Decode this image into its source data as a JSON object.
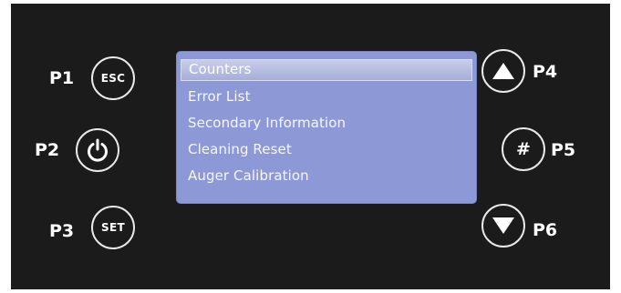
{
  "screen": {
    "menu_items": [
      {
        "label": "Counters",
        "selected": true
      },
      {
        "label": "Error List",
        "selected": false
      },
      {
        "label": "Secondary Information",
        "selected": false
      },
      {
        "label": "Cleaning Reset",
        "selected": false
      },
      {
        "label": "Auger Calibration",
        "selected": false
      }
    ]
  },
  "buttons": {
    "p1": {
      "label": "P1",
      "text": "ESC"
    },
    "p2": {
      "label": "P2",
      "icon": "power-icon"
    },
    "p3": {
      "label": "P3",
      "text": "SET"
    },
    "p4": {
      "label": "P4",
      "icon": "triangle-up-icon"
    },
    "p5": {
      "label": "P5",
      "text": "#"
    },
    "p6": {
      "label": "P6",
      "icon": "triangle-down-icon"
    }
  },
  "colors": {
    "panel": "#1b1b1b",
    "screen": "#8d99d6",
    "button_outline": "#e9e9e9",
    "text": "#ffffff"
  }
}
